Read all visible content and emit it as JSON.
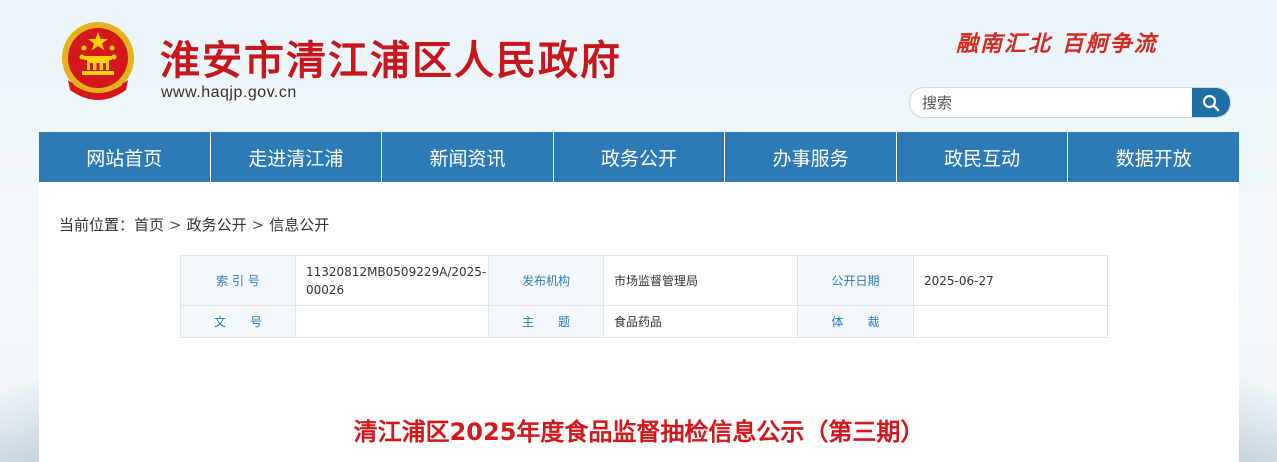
{
  "header": {
    "site_title": "淮安市清江浦区人民政府",
    "site_url": "www.haqjp.gov.cn",
    "slogan": "融南汇北 百舸争流",
    "search_placeholder": "搜索",
    "emblem_icon": "national-emblem-icon",
    "search_icon": "search-icon"
  },
  "nav": {
    "items": [
      "网站首页",
      "走进清江浦",
      "新闻资讯",
      "政务公开",
      "办事服务",
      "政民互动",
      "数据开放"
    ]
  },
  "breadcrumb": {
    "prefix": "当前位置：",
    "items": [
      "首页",
      "政务公开",
      "信息公开"
    ],
    "separator": ">"
  },
  "meta": {
    "index_label": "索 引 号",
    "index_value": "11320812MB0509229A/2025-00026",
    "publisher_label": "发布机构",
    "publisher_value": "市场监督管理局",
    "date_label": "公开日期",
    "date_value": "2025-06-27",
    "doc_no_label": "文　　号",
    "doc_no_value": "",
    "topic_label": "主　　题",
    "topic_value": "食品药品",
    "genre_label": "体　　裁",
    "genre_value": ""
  },
  "article": {
    "title": "清江浦区2025年度食品监督抽检信息公示（第三期）"
  },
  "colors": {
    "brand_red": "#c8161d",
    "nav_blue": "#2c7bb6",
    "label_bg": "#f3f8fc",
    "title_red": "#d4171b"
  }
}
